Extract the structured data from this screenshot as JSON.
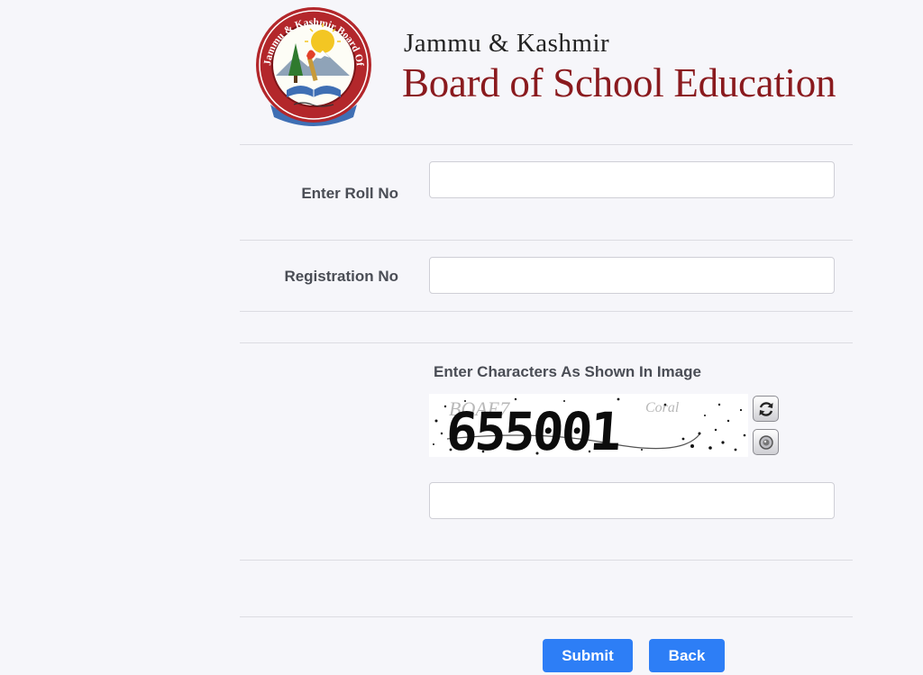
{
  "header": {
    "title_small": "Jammu & Kashmir",
    "title_big": "Board of School Education",
    "logo_ring_text": "Jammu & Kashmir Board Of School Education"
  },
  "form": {
    "roll_no": {
      "label": "Enter Roll No",
      "value": ""
    },
    "registration_no": {
      "label": "Registration No",
      "value": ""
    },
    "captcha": {
      "label": "Enter Characters As Shown In Image",
      "image_text": "655001",
      "value": "",
      "refresh_icon": "refresh-icon",
      "audio_icon": "speaker-icon"
    }
  },
  "actions": {
    "submit_label": "Submit",
    "back_label": "Back"
  },
  "colors": {
    "page_background": "#f6f6fa",
    "brand_red": "#8a1a1e",
    "button_blue": "#2d7ef6",
    "label_gray": "#4a4d55"
  }
}
